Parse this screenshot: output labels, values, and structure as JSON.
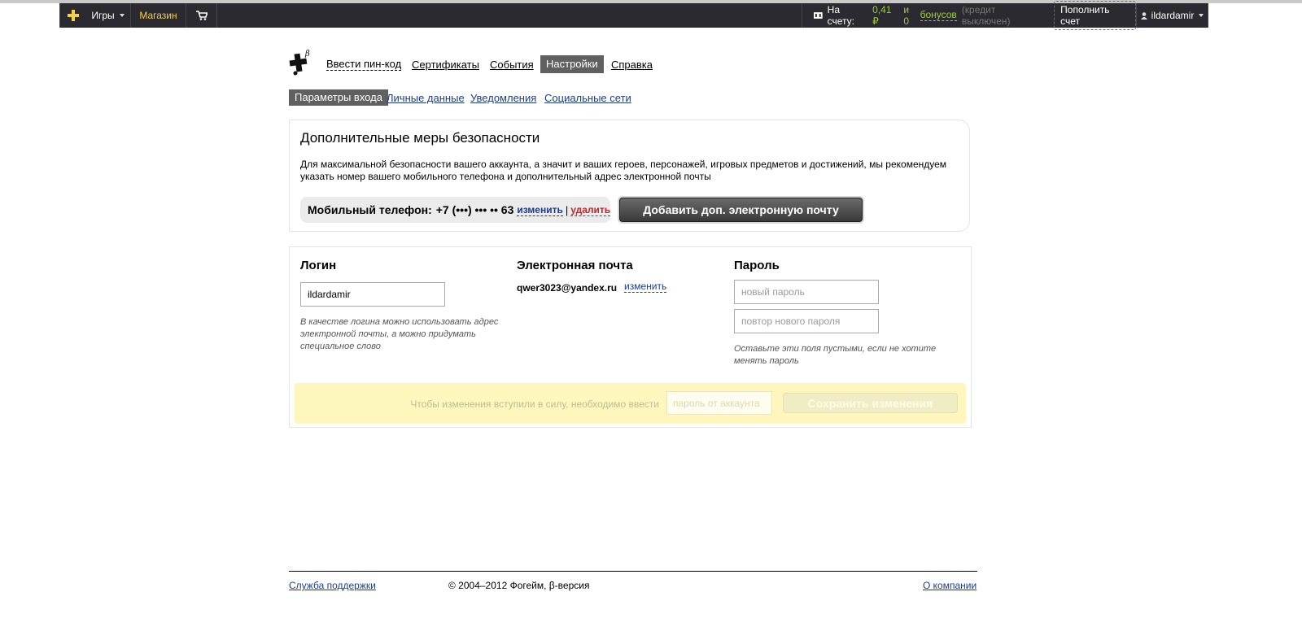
{
  "topbar": {
    "games_label": "Игры",
    "shop_label": "Магазин",
    "balance_label": "На счету:",
    "balance_value": "0,41 ₽",
    "bonus_and": "и 0",
    "bonus_label": "бонусов",
    "credit_label": "(кредит выключен)",
    "topup_label": "Пополнить счет",
    "username": "ildardamir"
  },
  "nav": {
    "pin": "Ввести пин-код",
    "certificates": "Сертификаты",
    "events": "События",
    "settings": "Настройки",
    "help": "Справка"
  },
  "subnav": {
    "login_params": "Параметры входа",
    "personal": "Личные данные",
    "notifications": "Уведомления",
    "social": "Социальные сети"
  },
  "security": {
    "title": "Дополнительные меры безопасности",
    "description": "Для максимальной безопасности вашего аккаунта, а значит и ваших героев, персонажей, игровых предметов и достижений, мы рекомендуем указать номер вашего мобильного телефона и дополнительный адрес электронной почты",
    "phone_label": "Мобильный телефон:",
    "phone_value": "+7 (•••) ••• •• 63",
    "change_label": "изменить",
    "separator": "|",
    "delete_label": "удалить",
    "add_email_label": "Добавить доп. электронную почту"
  },
  "form": {
    "login_title": "Логин",
    "login_value": "ildardamir",
    "login_hint": "В качестве логина можно использовать адрес электронной почты, а можно придумать специальное слово",
    "email_title": "Электронная почта",
    "email_value": "qwer3023@yandex.ru",
    "email_change": "изменить",
    "password_title": "Пароль",
    "new_password_placeholder": "новый пароль",
    "repeat_password_placeholder": "повтор нового пароля",
    "password_hint": "Оставьте эти поля пустыми, если не хотите менять пароль",
    "save_note": "Чтобы изменения вступили в силу, необходимо ввести",
    "account_password_placeholder": "пароль от аккаунта",
    "save_label": "Сохранить изменения"
  },
  "footer": {
    "support": "Служба поддержки",
    "copyright": "© 2004–2012 Фогейм, β-версия",
    "about": "О компании"
  },
  "colors": {
    "topbar_bg": "#2b2a30",
    "accent_yellow": "#f5d142",
    "balance_green": "#9acd32",
    "link_blue": "#1c3c92",
    "delete_red": "#c0282d",
    "active_tab": "#606060",
    "save_bar": "#fdf6bd"
  }
}
